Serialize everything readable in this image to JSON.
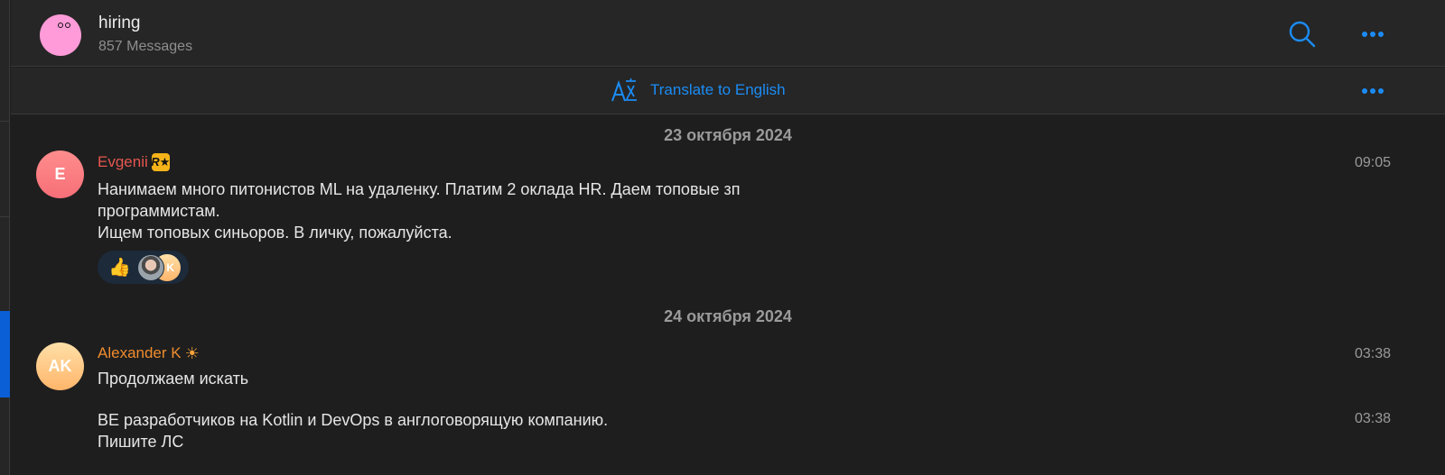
{
  "header": {
    "title": "hiring",
    "subtitle": "857 Messages",
    "avatar_icon": "group-avatar-face",
    "search_icon": "search-icon",
    "more_icon": "more-icon"
  },
  "translate_bar": {
    "label": "Translate to English",
    "icon": "translate-icon"
  },
  "colors": {
    "accent": "#1b8cf5",
    "sender_evgenii": "#e5574f",
    "sender_alexander": "#f08c2e",
    "background": "#1e1e1e",
    "header_bg": "#262626",
    "sidebar_selected": "#0a5fd6"
  },
  "messages": {
    "groups": [
      {
        "date": "23 октября 2024",
        "messages": [
          {
            "sender": "Evgenii",
            "initials": "E",
            "status_badge": "R★",
            "time": "09:05",
            "text": "Нанимаем много питонистов ML на удаленку. Платим 2 оклада HR. Даем топовые зп\nпрограммистам.\nИщем топовых синьоров. В личку, пожалуйста.",
            "reactions": [
              {
                "emoji": "👍",
                "reactor_avatars": [
                  "photo",
                  "K"
                ]
              }
            ]
          }
        ]
      },
      {
        "date": "24 октября 2024",
        "messages": [
          {
            "sender": "Alexander K",
            "initials": "AK",
            "status_badge": "☀",
            "time": "03:38",
            "text": "Продолжаем искать"
          },
          {
            "sender": "Alexander K",
            "time": "03:38",
            "text": "BE разработчиков на Kotlin и DevOps в англоговорящую компанию.\nПишите ЛС"
          }
        ]
      }
    ]
  }
}
